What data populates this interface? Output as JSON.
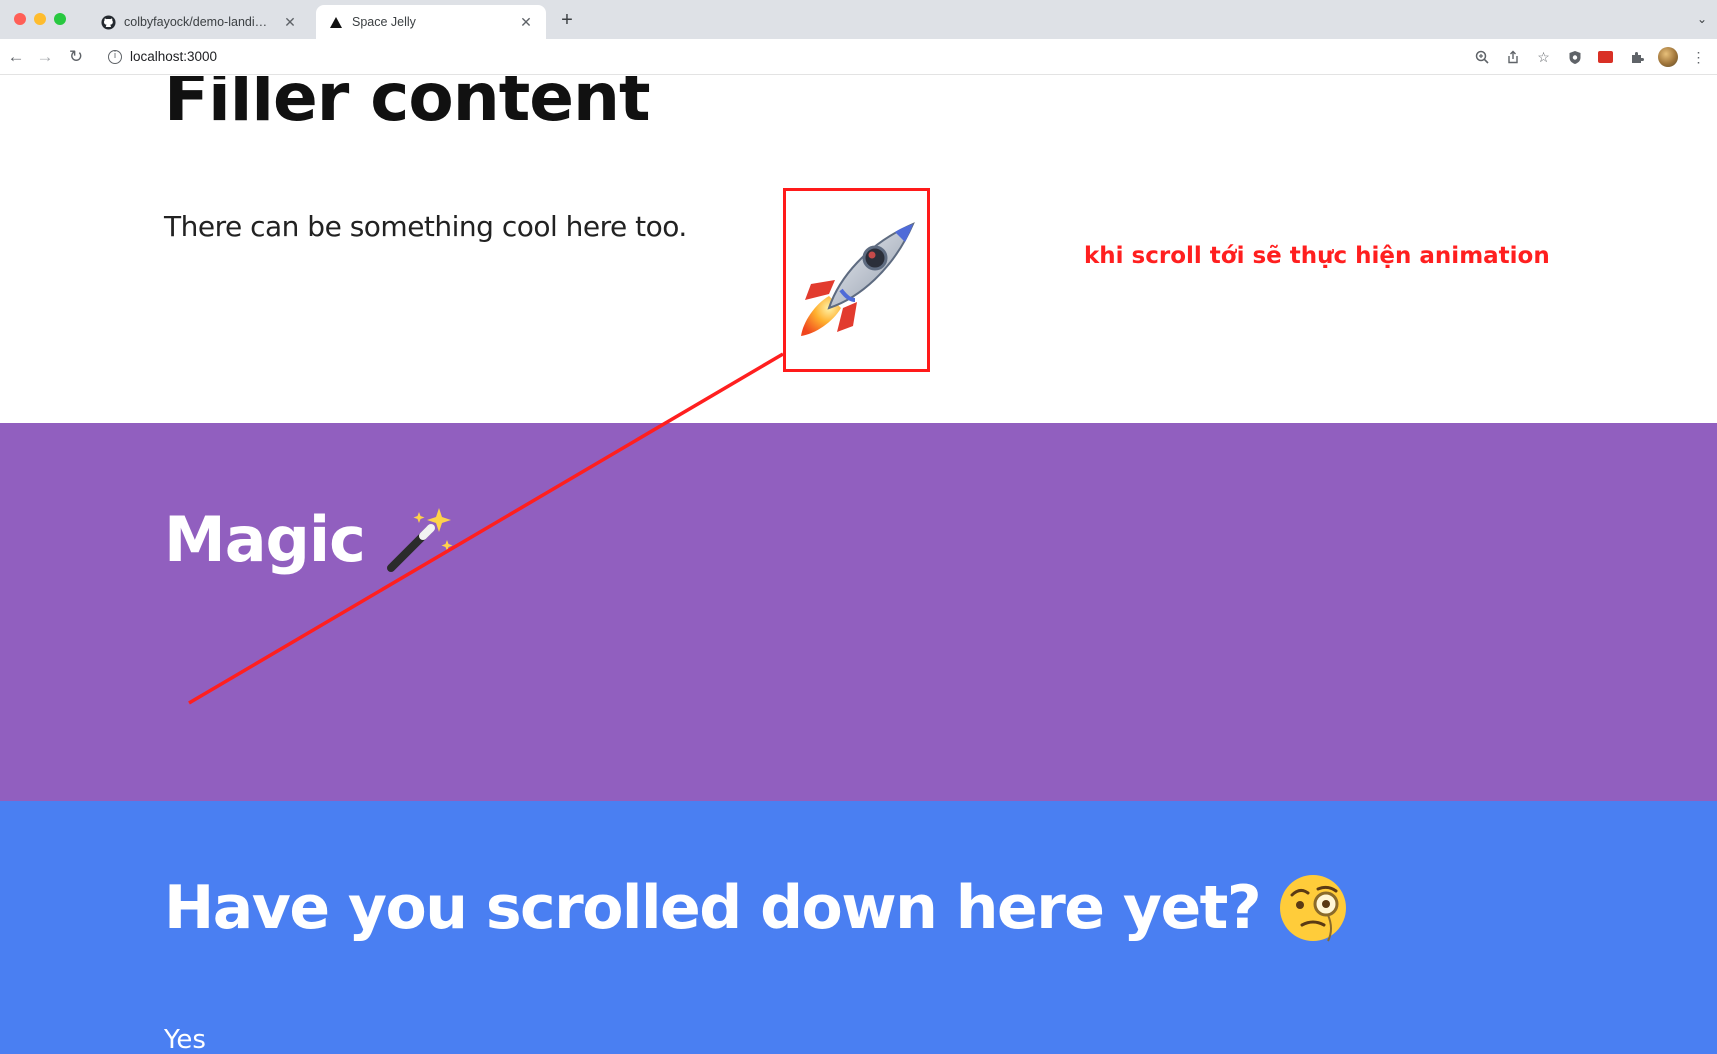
{
  "browser": {
    "tabs": [
      {
        "title": "colbyfayock/demo-landing-sta",
        "active": false,
        "favicon": "github-icon"
      },
      {
        "title": "Space Jelly",
        "active": true,
        "favicon": "triangle-icon"
      }
    ],
    "new_tab_label": "+",
    "address_bar": {
      "url": "localhost:3000"
    }
  },
  "page": {
    "filler": {
      "heading": "Filler content",
      "text": "There can be something cool here too."
    },
    "magic": {
      "heading": "Magic"
    },
    "scroll_section": {
      "heading": "Have you scrolled down here yet?",
      "answer": "Yes"
    }
  },
  "annotation": {
    "note": "khi scroll tới sẽ thực hiện animation",
    "color": "#ff1f1f"
  },
  "colors": {
    "magic_bg": "#915fbf",
    "scroll_bg": "#4a7ff2"
  }
}
